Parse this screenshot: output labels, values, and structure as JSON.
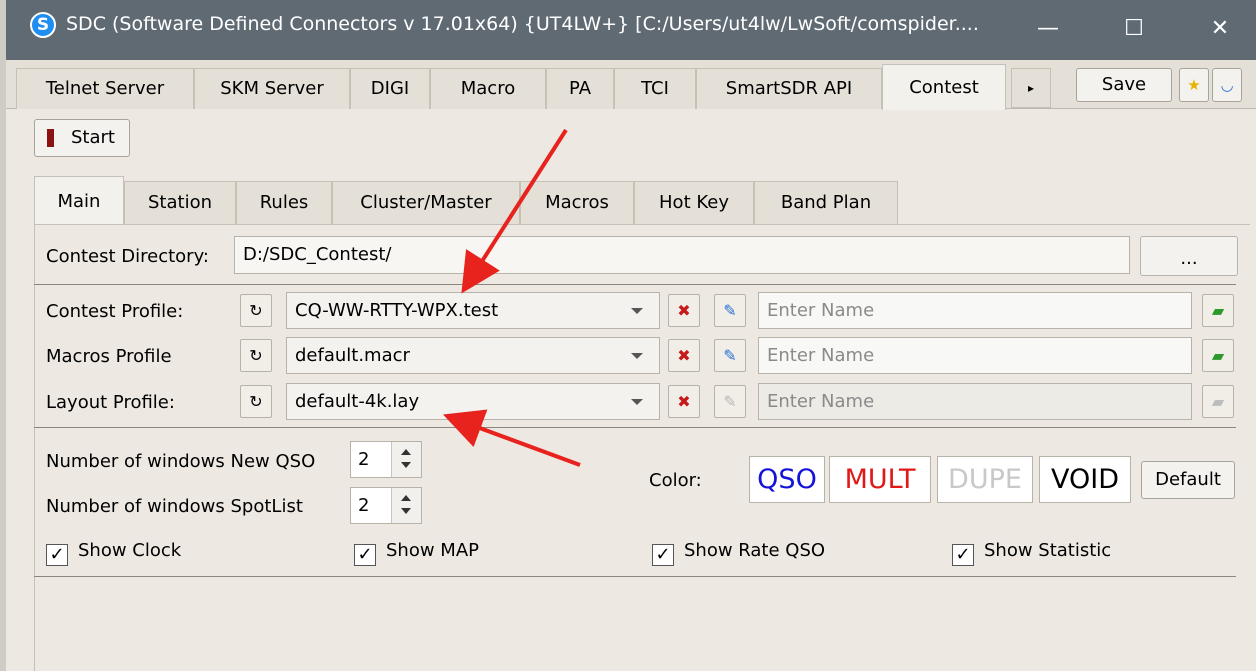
{
  "window": {
    "title": "SDC (Software Defined Connectors v 17.01x64) {UT4LW+} [C:/Users/ut4lw/LwSoft/comspider....",
    "app_icon": "S",
    "minimize_glyph": "—",
    "maximize_glyph": "☐",
    "close_glyph": "✕"
  },
  "top_tabs": [
    "Telnet Server",
    "SKM Server",
    "DIGI",
    "Macro",
    "PA",
    "TCI",
    "SmartSDR API",
    "Contest"
  ],
  "top_tabs_active": "Contest",
  "toolbar": {
    "save_label": "Save",
    "tab_scroll_glyph": "▸",
    "favorite_glyph": "★",
    "extra_glyph": "◡"
  },
  "start_button": {
    "label": "Start"
  },
  "inner_tabs": [
    "Main",
    "Station",
    "Rules",
    "Cluster/Master",
    "Macros",
    "Hot Key",
    "Band Plan"
  ],
  "inner_tabs_active": "Main",
  "main": {
    "contest_directory": {
      "label": "Contest Directory:",
      "value": "D:/SDC_Contest/",
      "browse_label": "..."
    },
    "profiles": [
      {
        "label": "Contest Profile:",
        "value": "CQ-WW-RTTY-WPX.test",
        "placeholder": "Enter Name",
        "enabled": true
      },
      {
        "label": "Macros Profile",
        "value": "default.macr",
        "placeholder": "Enter Name",
        "enabled": true
      },
      {
        "label": "Layout Profile:",
        "value": "default-4k.lay",
        "placeholder": "Enter Name",
        "enabled": false
      }
    ],
    "icons": {
      "refresh": "↻",
      "delete": "✖",
      "edit": "✎",
      "add": "▰"
    },
    "windows_new_qso": {
      "label": "Number of windows New QSO",
      "value": "2"
    },
    "windows_spotlist": {
      "label": "Number of windows SpotList",
      "value": "2"
    },
    "color": {
      "label": "Color:",
      "qso": {
        "text": "QSO",
        "color": "#1414d8"
      },
      "mult": {
        "text": "MULT",
        "color": "#e01818"
      },
      "dupe": {
        "text": "DUPE",
        "color": "#c8c8c8"
      },
      "void": {
        "text": "VOID",
        "color": "#000000"
      },
      "default_label": "Default"
    },
    "checks": [
      {
        "label": "Show Clock",
        "checked": true
      },
      {
        "label": "Show MAP",
        "checked": true
      },
      {
        "label": "Show Rate QSO",
        "checked": true
      },
      {
        "label": "Show Statistic",
        "checked": true
      }
    ],
    "check_glyph": "✓"
  },
  "annotation_arrow_color": "#e8231e"
}
